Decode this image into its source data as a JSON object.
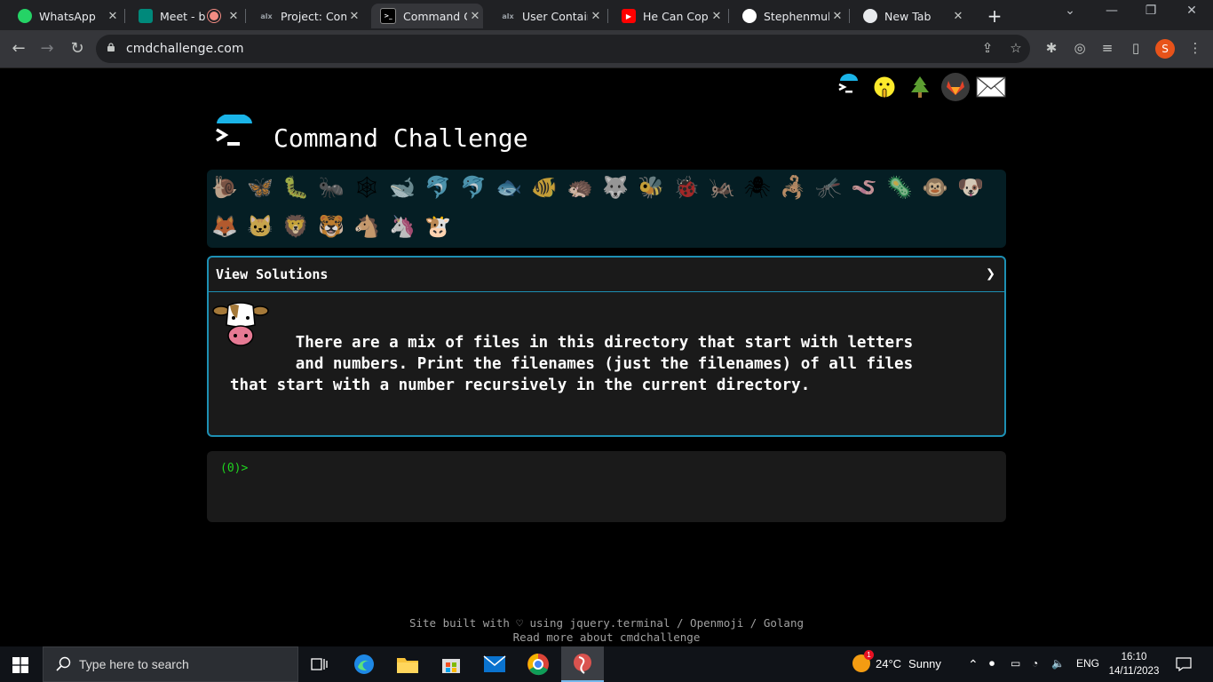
{
  "browser": {
    "tabs": [
      {
        "title": "WhatsApp",
        "favicon": "whatsapp-icon",
        "color": "#25d366"
      },
      {
        "title": "Meet - b",
        "favicon": "google-meet-icon",
        "color": "#00897b",
        "recording": true
      },
      {
        "title": "Project: Com",
        "favicon": "alx-icon",
        "color": "#5f6368"
      },
      {
        "title": "Command C",
        "favicon": "terminal-icon",
        "color": "#000000",
        "active": true
      },
      {
        "title": "User Contain",
        "favicon": "alx-icon",
        "color": "#5f6368"
      },
      {
        "title": "He Can Copy",
        "favicon": "youtube-icon",
        "color": "#ff0000"
      },
      {
        "title": "Stephenmuh",
        "favicon": "github-icon",
        "color": "#ffffff"
      },
      {
        "title": "New Tab",
        "favicon": "chrome-icon",
        "color": "#e8eaed"
      }
    ],
    "url": "cmdchallenge.com",
    "profile_initial": "S"
  },
  "page": {
    "title": "Command Challenge",
    "top_icons": [
      "terminal-icon",
      "shushing-face-icon",
      "tree-icon",
      "gitlab-icon",
      "mail-icon"
    ],
    "challenge_icons_row1": [
      "🐌",
      "🦋",
      "🐛",
      "🐜",
      "🕸",
      "🐋",
      "🐬",
      "🐬",
      "🐟",
      "🐠",
      "🦔",
      "🐺",
      "🐝",
      "🐞",
      "🦗",
      "🕷",
      "🦂",
      "🦟",
      "🪱",
      "🦠",
      "🐵",
      "🐶"
    ],
    "challenge_icons_row2": [
      "🦊",
      "🐱",
      "🦁",
      "🐯",
      "🐴",
      "🦄",
      "🐮"
    ],
    "panel": {
      "header": "View Solutions",
      "chevron": "❯",
      "problem_text": "       There are a mix of files in this directory that start with letters\n       and numbers. Print the filenames (just the filenames) of all files\nthat start with a number recursively in the current directory."
    },
    "terminal": {
      "prompt": "(0)>"
    },
    "footer": {
      "line1": "Site built with ♡ using jquery.terminal / Openmoji / Golang",
      "line2": "Read more about cmdchallenge"
    }
  },
  "taskbar": {
    "search_placeholder": "Type here to search",
    "weather": {
      "temp": "24°C",
      "condition": "Sunny",
      "badge": "1"
    },
    "language": "ENG",
    "time": "16:10",
    "date": "14/11/2023"
  }
}
